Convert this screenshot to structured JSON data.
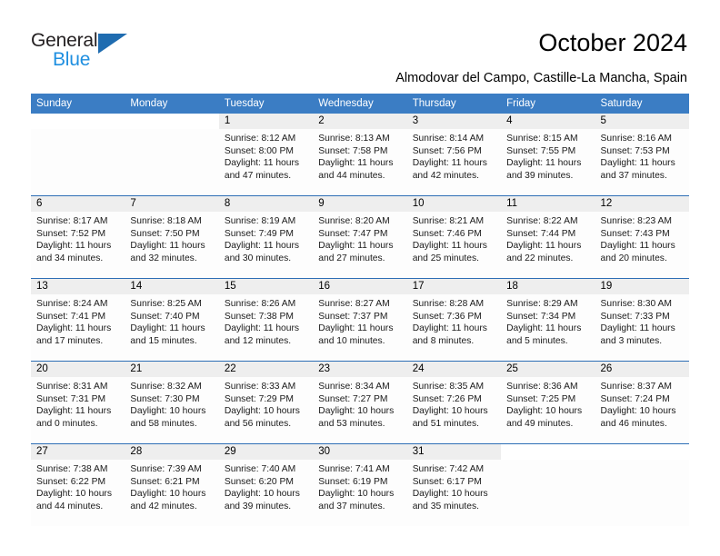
{
  "brand": {
    "name_part1": "General",
    "name_part2": "Blue",
    "triangle_color": "#1f6cb0",
    "blue_color": "#1f8fe0"
  },
  "header": {
    "title": "October 2024",
    "subtitle": "Almodovar del Campo, Castille-La Mancha, Spain"
  },
  "theme": {
    "header_bar_color": "#3b7dc4",
    "row_divider_color": "#2d6eb5",
    "daynum_band_color": "#eeeeee",
    "cell_background": "#fdfdfd"
  },
  "weekdays": [
    "Sunday",
    "Monday",
    "Tuesday",
    "Wednesday",
    "Thursday",
    "Friday",
    "Saturday"
  ],
  "labels": {
    "sunrise_prefix": "Sunrise:",
    "sunset_prefix": "Sunset:",
    "daylight_prefix": "Daylight:"
  },
  "weeks": [
    {
      "days": [
        {
          "num": "",
          "empty": true
        },
        {
          "num": "",
          "empty": true
        },
        {
          "num": "1",
          "sunrise": "Sunrise: 8:12 AM",
          "sunset": "Sunset: 8:00 PM",
          "daylight_1": "Daylight: 11 hours",
          "daylight_2": "and 47 minutes."
        },
        {
          "num": "2",
          "sunrise": "Sunrise: 8:13 AM",
          "sunset": "Sunset: 7:58 PM",
          "daylight_1": "Daylight: 11 hours",
          "daylight_2": "and 44 minutes."
        },
        {
          "num": "3",
          "sunrise": "Sunrise: 8:14 AM",
          "sunset": "Sunset: 7:56 PM",
          "daylight_1": "Daylight: 11 hours",
          "daylight_2": "and 42 minutes."
        },
        {
          "num": "4",
          "sunrise": "Sunrise: 8:15 AM",
          "sunset": "Sunset: 7:55 PM",
          "daylight_1": "Daylight: 11 hours",
          "daylight_2": "and 39 minutes."
        },
        {
          "num": "5",
          "sunrise": "Sunrise: 8:16 AM",
          "sunset": "Sunset: 7:53 PM",
          "daylight_1": "Daylight: 11 hours",
          "daylight_2": "and 37 minutes."
        }
      ]
    },
    {
      "days": [
        {
          "num": "6",
          "sunrise": "Sunrise: 8:17 AM",
          "sunset": "Sunset: 7:52 PM",
          "daylight_1": "Daylight: 11 hours",
          "daylight_2": "and 34 minutes."
        },
        {
          "num": "7",
          "sunrise": "Sunrise: 8:18 AM",
          "sunset": "Sunset: 7:50 PM",
          "daylight_1": "Daylight: 11 hours",
          "daylight_2": "and 32 minutes."
        },
        {
          "num": "8",
          "sunrise": "Sunrise: 8:19 AM",
          "sunset": "Sunset: 7:49 PM",
          "daylight_1": "Daylight: 11 hours",
          "daylight_2": "and 30 minutes."
        },
        {
          "num": "9",
          "sunrise": "Sunrise: 8:20 AM",
          "sunset": "Sunset: 7:47 PM",
          "daylight_1": "Daylight: 11 hours",
          "daylight_2": "and 27 minutes."
        },
        {
          "num": "10",
          "sunrise": "Sunrise: 8:21 AM",
          "sunset": "Sunset: 7:46 PM",
          "daylight_1": "Daylight: 11 hours",
          "daylight_2": "and 25 minutes."
        },
        {
          "num": "11",
          "sunrise": "Sunrise: 8:22 AM",
          "sunset": "Sunset: 7:44 PM",
          "daylight_1": "Daylight: 11 hours",
          "daylight_2": "and 22 minutes."
        },
        {
          "num": "12",
          "sunrise": "Sunrise: 8:23 AM",
          "sunset": "Sunset: 7:43 PM",
          "daylight_1": "Daylight: 11 hours",
          "daylight_2": "and 20 minutes."
        }
      ]
    },
    {
      "days": [
        {
          "num": "13",
          "sunrise": "Sunrise: 8:24 AM",
          "sunset": "Sunset: 7:41 PM",
          "daylight_1": "Daylight: 11 hours",
          "daylight_2": "and 17 minutes."
        },
        {
          "num": "14",
          "sunrise": "Sunrise: 8:25 AM",
          "sunset": "Sunset: 7:40 PM",
          "daylight_1": "Daylight: 11 hours",
          "daylight_2": "and 15 minutes."
        },
        {
          "num": "15",
          "sunrise": "Sunrise: 8:26 AM",
          "sunset": "Sunset: 7:38 PM",
          "daylight_1": "Daylight: 11 hours",
          "daylight_2": "and 12 minutes."
        },
        {
          "num": "16",
          "sunrise": "Sunrise: 8:27 AM",
          "sunset": "Sunset: 7:37 PM",
          "daylight_1": "Daylight: 11 hours",
          "daylight_2": "and 10 minutes."
        },
        {
          "num": "17",
          "sunrise": "Sunrise: 8:28 AM",
          "sunset": "Sunset: 7:36 PM",
          "daylight_1": "Daylight: 11 hours",
          "daylight_2": "and 8 minutes."
        },
        {
          "num": "18",
          "sunrise": "Sunrise: 8:29 AM",
          "sunset": "Sunset: 7:34 PM",
          "daylight_1": "Daylight: 11 hours",
          "daylight_2": "and 5 minutes."
        },
        {
          "num": "19",
          "sunrise": "Sunrise: 8:30 AM",
          "sunset": "Sunset: 7:33 PM",
          "daylight_1": "Daylight: 11 hours",
          "daylight_2": "and 3 minutes."
        }
      ]
    },
    {
      "days": [
        {
          "num": "20",
          "sunrise": "Sunrise: 8:31 AM",
          "sunset": "Sunset: 7:31 PM",
          "daylight_1": "Daylight: 11 hours",
          "daylight_2": "and 0 minutes."
        },
        {
          "num": "21",
          "sunrise": "Sunrise: 8:32 AM",
          "sunset": "Sunset: 7:30 PM",
          "daylight_1": "Daylight: 10 hours",
          "daylight_2": "and 58 minutes."
        },
        {
          "num": "22",
          "sunrise": "Sunrise: 8:33 AM",
          "sunset": "Sunset: 7:29 PM",
          "daylight_1": "Daylight: 10 hours",
          "daylight_2": "and 56 minutes."
        },
        {
          "num": "23",
          "sunrise": "Sunrise: 8:34 AM",
          "sunset": "Sunset: 7:27 PM",
          "daylight_1": "Daylight: 10 hours",
          "daylight_2": "and 53 minutes."
        },
        {
          "num": "24",
          "sunrise": "Sunrise: 8:35 AM",
          "sunset": "Sunset: 7:26 PM",
          "daylight_1": "Daylight: 10 hours",
          "daylight_2": "and 51 minutes."
        },
        {
          "num": "25",
          "sunrise": "Sunrise: 8:36 AM",
          "sunset": "Sunset: 7:25 PM",
          "daylight_1": "Daylight: 10 hours",
          "daylight_2": "and 49 minutes."
        },
        {
          "num": "26",
          "sunrise": "Sunrise: 8:37 AM",
          "sunset": "Sunset: 7:24 PM",
          "daylight_1": "Daylight: 10 hours",
          "daylight_2": "and 46 minutes."
        }
      ]
    },
    {
      "days": [
        {
          "num": "27",
          "sunrise": "Sunrise: 7:38 AM",
          "sunset": "Sunset: 6:22 PM",
          "daylight_1": "Daylight: 10 hours",
          "daylight_2": "and 44 minutes."
        },
        {
          "num": "28",
          "sunrise": "Sunrise: 7:39 AM",
          "sunset": "Sunset: 6:21 PM",
          "daylight_1": "Daylight: 10 hours",
          "daylight_2": "and 42 minutes."
        },
        {
          "num": "29",
          "sunrise": "Sunrise: 7:40 AM",
          "sunset": "Sunset: 6:20 PM",
          "daylight_1": "Daylight: 10 hours",
          "daylight_2": "and 39 minutes."
        },
        {
          "num": "30",
          "sunrise": "Sunrise: 7:41 AM",
          "sunset": "Sunset: 6:19 PM",
          "daylight_1": "Daylight: 10 hours",
          "daylight_2": "and 37 minutes."
        },
        {
          "num": "31",
          "sunrise": "Sunrise: 7:42 AM",
          "sunset": "Sunset: 6:17 PM",
          "daylight_1": "Daylight: 10 hours",
          "daylight_2": "and 35 minutes."
        },
        {
          "num": "",
          "empty": true
        },
        {
          "num": "",
          "empty": true
        }
      ]
    }
  ]
}
